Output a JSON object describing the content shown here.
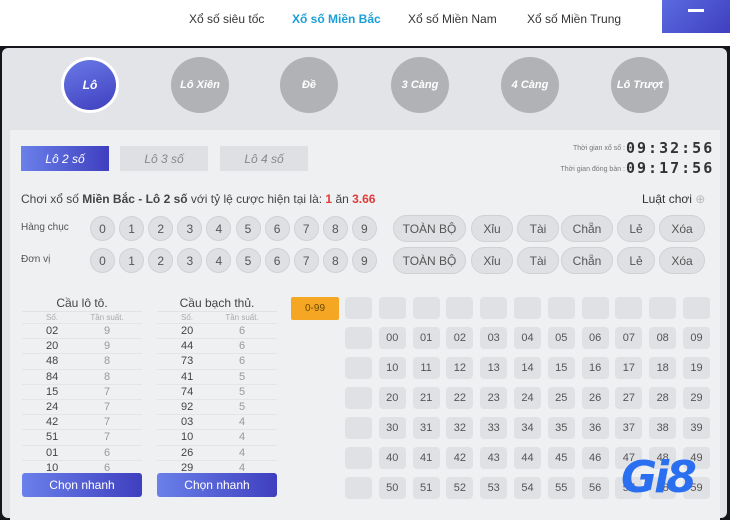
{
  "nav": {
    "items": [
      "Xổ số siêu tốc",
      "Xổ số Miền Bắc",
      "Xổ số Miền Nam",
      "Xổ số Miền Trung"
    ],
    "active": 1
  },
  "games": [
    "Lô",
    "Lô Xiên",
    "Đề",
    "3 Càng",
    "4 Càng",
    "Lô Trượt"
  ],
  "tabs": [
    "Lô 2 số",
    "Lô 3 số",
    "Lô 4 số"
  ],
  "timer": {
    "draw_label": "Thời gian xổ số :",
    "draw_value": "09:32:56",
    "close_label": "Thời gian đóng bàn :",
    "close_value": "09:17:56"
  },
  "desc": {
    "prefix": "Chơi xổ số ",
    "region": "Miền Bắc - Lô 2 số",
    "middle": " với tỷ lệ cược hiện tại là: ",
    "one": "1",
    "an": " ăn ",
    "odds": "3.66"
  },
  "rules_label": "Luật chơi",
  "rows": [
    {
      "label": "Hàng chục"
    },
    {
      "label": "Đơn vị"
    }
  ],
  "digits": [
    "0",
    "1",
    "2",
    "3",
    "4",
    "5",
    "6",
    "7",
    "8",
    "9"
  ],
  "quick": [
    "TOÀN BỘ",
    "Xỉu",
    "Tài",
    "Chẵn",
    "Lẻ",
    "Xóa"
  ],
  "tables": [
    {
      "title": "Cầu lô tô.",
      "col1": "Số.",
      "col2": "Tần suất.",
      "rows": [
        [
          "02",
          "9"
        ],
        [
          "20",
          "9"
        ],
        [
          "48",
          "8"
        ],
        [
          "84",
          "8"
        ],
        [
          "15",
          "7"
        ],
        [
          "24",
          "7"
        ],
        [
          "42",
          "7"
        ],
        [
          "51",
          "7"
        ],
        [
          "01",
          "6"
        ],
        [
          "10",
          "6"
        ]
      ],
      "button": "Chọn nhanh"
    },
    {
      "title": "Cầu bạch thủ.",
      "col1": "Số.",
      "col2": "Tần suất.",
      "rows": [
        [
          "20",
          "6"
        ],
        [
          "44",
          "6"
        ],
        [
          "73",
          "6"
        ],
        [
          "41",
          "5"
        ],
        [
          "74",
          "5"
        ],
        [
          "92",
          "5"
        ],
        [
          "03",
          "4"
        ],
        [
          "10",
          "4"
        ],
        [
          "26",
          "4"
        ],
        [
          "29",
          "4"
        ]
      ],
      "button": "Chọn nhanh"
    }
  ],
  "range_label": "0-99",
  "logo": "Gi8",
  "colors": {
    "accent": "#3f3fbf",
    "active_nav": "#1a9fd9",
    "odds": "#e03a3a",
    "range": "#f5a623"
  }
}
